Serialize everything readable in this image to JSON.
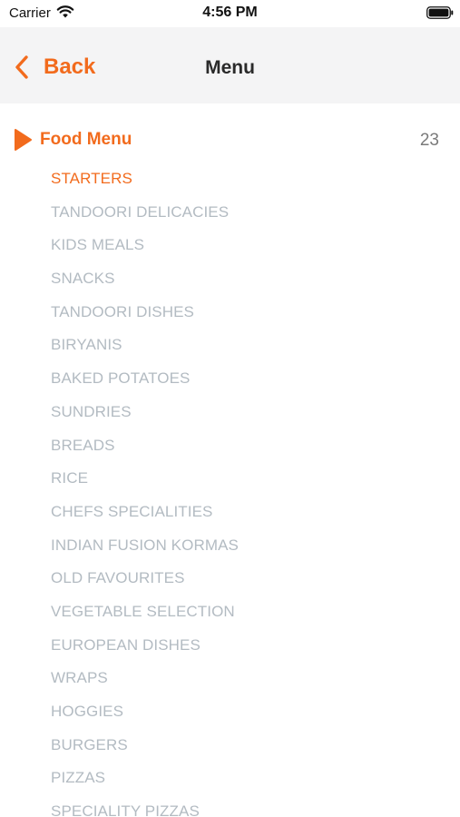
{
  "status_bar": {
    "carrier": "Carrier",
    "time": "4:56 PM",
    "wifi_icon": "wifi-icon",
    "battery_icon": "battery-icon"
  },
  "nav": {
    "back_label": "Back",
    "title": "Menu",
    "accent_color": "#f26b1d",
    "background_color": "#f4f4f5"
  },
  "section": {
    "title": "Food Menu",
    "count": "23",
    "icon": "play-icon"
  },
  "categories": [
    {
      "label": "STARTERS",
      "active": true
    },
    {
      "label": "TANDOORI DELICACIES",
      "active": false
    },
    {
      "label": "KIDS MEALS",
      "active": false
    },
    {
      "label": "SNACKS",
      "active": false
    },
    {
      "label": "TANDOORI DISHES",
      "active": false
    },
    {
      "label": "BIRYANIS",
      "active": false
    },
    {
      "label": "BAKED POTATOES",
      "active": false
    },
    {
      "label": "SUNDRIES",
      "active": false
    },
    {
      "label": "BREADS",
      "active": false
    },
    {
      "label": "RICE",
      "active": false
    },
    {
      "label": "CHEFS SPECIALITIES",
      "active": false
    },
    {
      "label": "INDIAN FUSION KORMAS",
      "active": false
    },
    {
      "label": "OLD FAVOURITES",
      "active": false
    },
    {
      "label": "VEGETABLE SELECTION",
      "active": false
    },
    {
      "label": "EUROPEAN DISHES",
      "active": false
    },
    {
      "label": "WRAPS",
      "active": false
    },
    {
      "label": "HOGGIES",
      "active": false
    },
    {
      "label": "BURGERS",
      "active": false
    },
    {
      "label": "PIZZAS",
      "active": false
    },
    {
      "label": "SPECIALITY PIZZAS",
      "active": false
    }
  ]
}
